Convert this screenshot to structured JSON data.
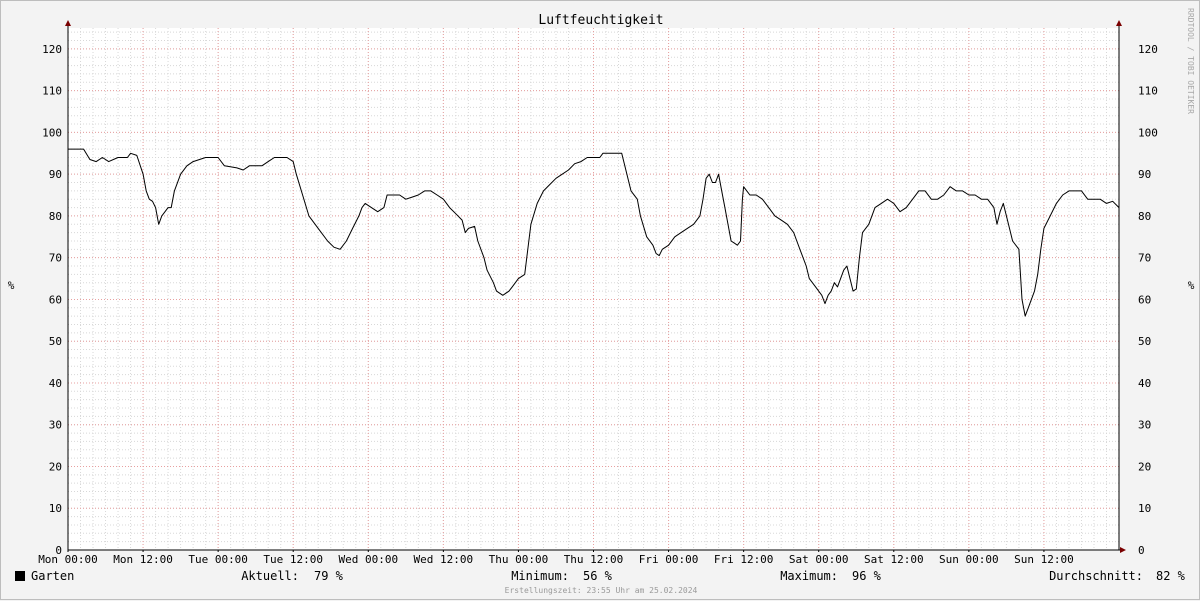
{
  "chart_data": {
    "type": "line",
    "title": "Luftfeuchtigkeit",
    "ylabel": "%",
    "ylim": [
      0,
      125
    ],
    "y_ticks": [
      0,
      10,
      20,
      30,
      40,
      50,
      60,
      70,
      80,
      90,
      100,
      110,
      120
    ],
    "x_range_hours": [
      0,
      168
    ],
    "x_ticks": [
      {
        "h": 0,
        "label": "Mon 00:00"
      },
      {
        "h": 12,
        "label": "Mon 12:00"
      },
      {
        "h": 24,
        "label": "Tue 00:00"
      },
      {
        "h": 36,
        "label": "Tue 12:00"
      },
      {
        "h": 48,
        "label": "Wed 00:00"
      },
      {
        "h": 60,
        "label": "Wed 12:00"
      },
      {
        "h": 72,
        "label": "Thu 00:00"
      },
      {
        "h": 84,
        "label": "Thu 12:00"
      },
      {
        "h": 96,
        "label": "Fri 00:00"
      },
      {
        "h": 108,
        "label": "Fri 12:00"
      },
      {
        "h": 120,
        "label": "Sat 00:00"
      },
      {
        "h": 132,
        "label": "Sat 12:00"
      },
      {
        "h": 144,
        "label": "Sun 00:00"
      },
      {
        "h": 156,
        "label": "Sun 12:00"
      }
    ],
    "grid": true,
    "series": [
      {
        "name": "Garten",
        "color": "#000000",
        "points": [
          [
            0,
            96
          ],
          [
            2.5,
            96
          ],
          [
            3.5,
            93.5
          ],
          [
            4.5,
            93
          ],
          [
            5.5,
            94
          ],
          [
            6.5,
            93
          ],
          [
            8,
            94
          ],
          [
            9.5,
            94
          ],
          [
            10,
            95
          ],
          [
            11,
            94.5
          ],
          [
            12,
            90
          ],
          [
            12.5,
            86
          ],
          [
            13,
            84
          ],
          [
            13.5,
            83.5
          ],
          [
            14,
            82
          ],
          [
            14.5,
            78
          ],
          [
            15,
            80
          ],
          [
            15.5,
            81
          ],
          [
            16,
            82
          ],
          [
            16.5,
            82
          ],
          [
            17,
            86
          ],
          [
            18,
            90
          ],
          [
            19,
            92
          ],
          [
            20,
            93
          ],
          [
            22,
            94
          ],
          [
            24,
            94
          ],
          [
            25,
            92
          ],
          [
            27,
            91.5
          ],
          [
            28,
            91
          ],
          [
            29,
            92
          ],
          [
            31,
            92
          ],
          [
            32,
            93
          ],
          [
            33,
            94
          ],
          [
            35,
            94
          ],
          [
            36,
            93
          ],
          [
            36.5,
            90
          ],
          [
            37.5,
            85
          ],
          [
            38.5,
            80
          ],
          [
            40,
            77
          ],
          [
            41.5,
            74
          ],
          [
            42.5,
            72.5
          ],
          [
            43.5,
            72
          ],
          [
            44.5,
            74
          ],
          [
            45.5,
            77
          ],
          [
            46.5,
            80
          ],
          [
            47,
            82
          ],
          [
            47.5,
            83
          ],
          [
            48.5,
            82
          ],
          [
            49.5,
            81
          ],
          [
            50.5,
            82
          ],
          [
            51,
            85
          ],
          [
            53,
            85
          ],
          [
            54,
            84
          ],
          [
            55,
            84.5
          ],
          [
            56,
            85
          ],
          [
            57,
            86
          ],
          [
            58,
            86
          ],
          [
            59,
            85
          ],
          [
            60,
            84
          ],
          [
            61,
            82
          ],
          [
            62,
            80.5
          ],
          [
            63,
            79
          ],
          [
            63.5,
            76
          ],
          [
            64,
            77
          ],
          [
            65,
            77.5
          ],
          [
            65.5,
            74
          ],
          [
            66.5,
            70
          ],
          [
            67,
            67
          ],
          [
            68,
            64
          ],
          [
            68.5,
            62
          ],
          [
            69.5,
            61
          ],
          [
            70.5,
            62
          ],
          [
            71,
            63
          ],
          [
            72,
            65
          ],
          [
            73,
            66
          ],
          [
            73.5,
            72
          ],
          [
            74,
            78
          ],
          [
            75,
            83
          ],
          [
            76,
            86
          ],
          [
            77,
            87.5
          ],
          [
            78,
            89
          ],
          [
            79,
            90
          ],
          [
            80,
            91
          ],
          [
            81,
            92.5
          ],
          [
            82,
            93
          ],
          [
            83,
            94
          ],
          [
            85,
            94
          ],
          [
            85.5,
            95
          ],
          [
            88.5,
            95
          ],
          [
            89,
            92
          ],
          [
            90,
            86
          ],
          [
            91,
            84
          ],
          [
            91.5,
            80
          ],
          [
            92.5,
            75
          ],
          [
            93.5,
            73
          ],
          [
            94,
            71
          ],
          [
            94.5,
            70.5
          ],
          [
            95,
            72
          ],
          [
            96,
            73
          ],
          [
            97,
            75
          ],
          [
            98,
            76
          ],
          [
            99,
            77
          ],
          [
            100,
            78
          ],
          [
            101,
            80
          ],
          [
            101.5,
            84
          ],
          [
            102,
            89
          ],
          [
            102.5,
            90
          ],
          [
            103,
            88
          ],
          [
            103.5,
            88
          ],
          [
            104,
            90
          ],
          [
            104.5,
            86
          ],
          [
            105,
            82
          ],
          [
            105.5,
            78
          ],
          [
            106,
            74
          ],
          [
            106.5,
            73.5
          ],
          [
            107,
            73
          ],
          [
            107.5,
            74
          ],
          [
            107.8,
            84
          ],
          [
            108,
            87
          ],
          [
            108.5,
            86
          ],
          [
            109,
            85
          ],
          [
            110,
            85
          ],
          [
            111,
            84
          ],
          [
            112,
            82
          ],
          [
            113,
            80
          ],
          [
            114,
            79
          ],
          [
            115,
            78
          ],
          [
            116,
            76
          ],
          [
            116.5,
            74
          ],
          [
            117,
            72
          ],
          [
            118,
            68
          ],
          [
            118.5,
            65
          ],
          [
            119.5,
            63
          ],
          [
            120.5,
            61
          ],
          [
            121,
            59
          ],
          [
            121.5,
            61
          ],
          [
            122,
            62
          ],
          [
            122.5,
            64
          ],
          [
            123,
            63
          ],
          [
            123.5,
            65
          ],
          [
            124,
            67
          ],
          [
            124.5,
            68
          ],
          [
            125,
            65
          ],
          [
            125.5,
            62
          ],
          [
            126,
            62.5
          ],
          [
            126.5,
            70
          ],
          [
            127,
            76
          ],
          [
            128,
            78
          ],
          [
            129,
            82
          ],
          [
            130,
            83
          ],
          [
            131,
            84
          ],
          [
            132,
            83
          ],
          [
            133,
            81
          ],
          [
            134,
            82
          ],
          [
            135,
            84
          ],
          [
            136,
            86
          ],
          [
            137,
            86
          ],
          [
            138,
            84
          ],
          [
            139,
            84
          ],
          [
            140,
            85
          ],
          [
            141,
            87
          ],
          [
            142,
            86
          ],
          [
            143,
            86
          ],
          [
            144,
            85
          ],
          [
            145,
            85
          ],
          [
            146,
            84
          ],
          [
            147,
            84
          ],
          [
            148,
            82
          ],
          [
            148.5,
            78
          ],
          [
            149,
            81
          ],
          [
            149.5,
            83
          ],
          [
            150,
            80
          ],
          [
            150.5,
            77
          ],
          [
            151,
            74
          ],
          [
            152,
            72
          ],
          [
            152.5,
            60
          ],
          [
            153,
            56
          ],
          [
            153.5,
            58
          ],
          [
            154,
            60
          ],
          [
            154.5,
            62
          ],
          [
            155,
            66
          ],
          [
            155.5,
            72
          ],
          [
            156,
            77
          ],
          [
            157,
            80
          ],
          [
            158,
            83
          ],
          [
            159,
            85
          ],
          [
            160,
            86
          ],
          [
            162,
            86
          ],
          [
            163,
            84
          ],
          [
            165,
            84
          ],
          [
            166,
            83
          ],
          [
            167,
            83.5
          ],
          [
            168,
            82
          ]
        ]
      }
    ]
  },
  "legend": {
    "series_name": "Garten",
    "color": "#000000",
    "current_label": "Aktuell:",
    "current_value": "79 %",
    "min_label": "Minimum:",
    "min_value": "56 %",
    "max_label": "Maximum:",
    "max_value": "96 %",
    "avg_label": "Durchschnitt:",
    "avg_value": "82 %"
  },
  "footer": "Erstellungszeit: 23:55 Uhr am 25.02.2024",
  "watermark": "RRDTOOL / TOBI OETIKER",
  "colors": {
    "background": "#f3f3f3",
    "plot_background": "#ffffff",
    "minor_grid": "#d8d8d8",
    "major_grid": "#e8a0a0",
    "axis": "#7a0000"
  }
}
